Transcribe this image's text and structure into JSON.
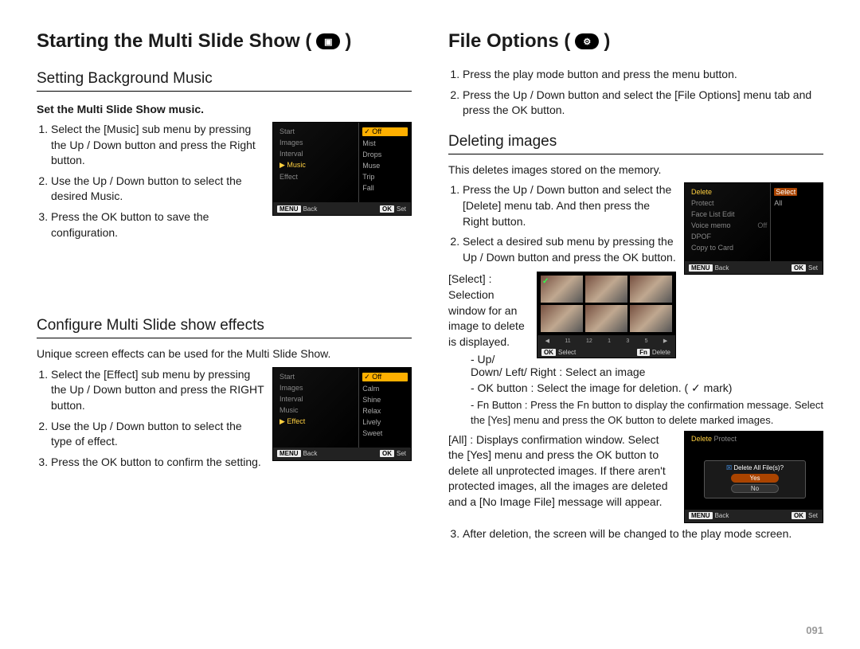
{
  "pageNumber": "091",
  "left": {
    "title": "Starting the Multi Slide Show (",
    "titleClose": ")",
    "sections": [
      {
        "heading": "Setting Background Music",
        "subheading": "Set the Multi Slide Show music.",
        "steps": [
          "Select the [Music] sub menu by pressing the Up / Down button and press the Right button.",
          "Use the Up / Down button to select the desired Music.",
          "Press the OK button to save the configuration."
        ],
        "lcd": {
          "leftItems": [
            "Start",
            "Images",
            "Interval",
            "Music",
            "Effect"
          ],
          "leftSelectedIndex": 3,
          "rightItems": [
            "Off",
            "Mist",
            "Drops",
            "Muse",
            "Trip",
            "Fall"
          ],
          "rightSelectedIndex": 0,
          "rightCheckIndex": 0,
          "footerLeft": "Back",
          "footerLeftBtn": "MENU",
          "footerRight": "Set",
          "footerRightBtn": "OK"
        }
      },
      {
        "heading": "Configure Multi Slide show effects",
        "intro": "Unique screen effects can be used for the Multi Slide Show.",
        "steps": [
          "Select the [Effect] sub menu by pressing the Up / Down button and press the RIGHT button.",
          "Use the Up / Down button to select the type of effect.",
          "Press the OK button to confirm the setting."
        ],
        "lcd": {
          "leftItems": [
            "Start",
            "Images",
            "Interval",
            "Music",
            "Effect"
          ],
          "leftSelectedIndex": 4,
          "rightItems": [
            "Off",
            "Calm",
            "Shine",
            "Relax",
            "Lively",
            "Sweet"
          ],
          "rightSelectedIndex": 0,
          "rightCheckIndex": 0,
          "footerLeft": "Back",
          "footerLeftBtn": "MENU",
          "footerRight": "Set",
          "footerRightBtn": "OK"
        }
      }
    ]
  },
  "right": {
    "title": "File Options (",
    "titleClose": ")",
    "introSteps": [
      "Press the play mode button and press the menu button.",
      "Press the Up / Down button and select the [File Options] menu tab and press the OK button."
    ],
    "heading": "Deleting images",
    "intro": "This deletes images stored on the memory.",
    "steps": [
      "Press the Up / Down button and select the [Delete] menu tab. And then press the Right button.",
      "Select a desired sub menu by pressing the Up / Down button and press the OK button."
    ],
    "detailSelect": "[Select] : Selection window for an image to delete is displayed.",
    "detailSelectLines": [
      "- Up/ Down/ Left/ Right : Select an image",
      "- OK button : Select the image for deletion. ( ✓ mark)",
      "- Fn Button : Press the Fn button to display the confirmation message. Select the [Yes] menu and press the OK button to delete marked images."
    ],
    "detailAll": "[All] : Displays confirmation window. Select the [Yes] menu and press the OK button to delete all unprotected images. If there aren't protected images, all the images are deleted and a [No Image File] message will appear.",
    "step3": "After deletion, the screen will be changed to the play mode screen.",
    "lcdDelete": {
      "leftItems": [
        "Delete",
        "Protect",
        "Face List Edit",
        "Voice memo",
        "DPOF",
        "Copy to Card"
      ],
      "leftSelectedIndex": 0,
      "rightItems": [
        "Select",
        "All"
      ],
      "rightPillIndex": 0,
      "extraRight": "Off",
      "footerLeft": "Back",
      "footerLeftBtn": "MENU",
      "footerRight": "Set",
      "footerRightBtn": "OK"
    },
    "lcdThumbs": {
      "bar": [
        "◀",
        "11",
        "12",
        "1",
        "3",
        "5",
        "▶"
      ],
      "footerLeftBtn": "OK",
      "footerLeft": "Select",
      "footerRightBtn": "Fn",
      "footerRight": "Delete"
    },
    "lcdDialog": {
      "leftItems": [
        "Delete",
        "Protect"
      ],
      "leftSelectedIndex": 0,
      "question": "Delete All File(s)?",
      "yes": "Yes",
      "no": "No",
      "footerLeft": "Back",
      "footerLeftBtn": "MENU",
      "footerRight": "Set",
      "footerRightBtn": "OK"
    }
  }
}
